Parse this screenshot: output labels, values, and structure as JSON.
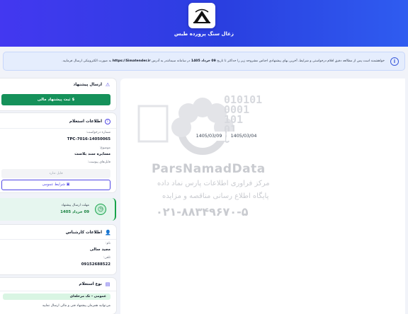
{
  "header": {
    "brand_title": "زغال سنگ پرورده طبس"
  },
  "notice": {
    "text_start": "خواهشمند است پس از مطالعه دقیق اقلام درخواستی و شرایط، آخرین بهای پیشنهادی اجناس مشروحه زیر را حداکثر تا تاریخ",
    "date": "09 خرداد 1405",
    "text_mid": "در سامانه سیمانتدر به آدرس",
    "url": "https://Simatender.ir",
    "text_end": "به صورت الکترونیکی ارسال فرمایید."
  },
  "offer_card": {
    "title": "ارسال پیشنهاد",
    "button_label": "ثبت پیشنهاد مالی"
  },
  "inquiry_card": {
    "title": "اطلاعات استعلام",
    "request_number_label": "شماره درخواست:",
    "request_number": "TPC-7016-14050065",
    "subject_label": "موضوع:",
    "subject": "مسابره سند بلاست",
    "attachments_label": "فایل‌های پیوست:",
    "attachments_placeholder": "فایل ندارد",
    "general_terms_button": "شرایط عمومی"
  },
  "deadline": {
    "label": "مهلت ارسال پیشنهاد",
    "date": "09 خرداد 1405"
  },
  "expert_card": {
    "title": "اطلاعات کارشناس",
    "name_label": "نام:",
    "name": "مجید سالی",
    "phone_label": "تلفن:",
    "phone": "09152688522"
  },
  "type_card": {
    "title": "نوع استعلام",
    "badge": "عمومی - تک مرحله‌ای",
    "description": "می‌توانید همزمان پیشنهاد فنی و مالی ارسال نمایید"
  },
  "dates": {
    "date_1": "1405/03/09",
    "date_2": "1405/03/04"
  },
  "watermark": {
    "brand": "ParsNamadData",
    "line_1": "مرکز فراوری اطلاعات پارس نماد داده",
    "line_2": "پایگاه اطلاع رسانی مناقصه و مزایده",
    "phone": "۰۲۱-۸۸۳۴۹۶۷۰-۵",
    "digits": "010101\n0001\n101\n01\n0"
  },
  "colors": {
    "header_start": "#4338f0",
    "header_end": "#2f5cf0",
    "primary_button": "#15915a",
    "accent": "#4f46e5",
    "deadline_bg": "#e6f6ef"
  }
}
